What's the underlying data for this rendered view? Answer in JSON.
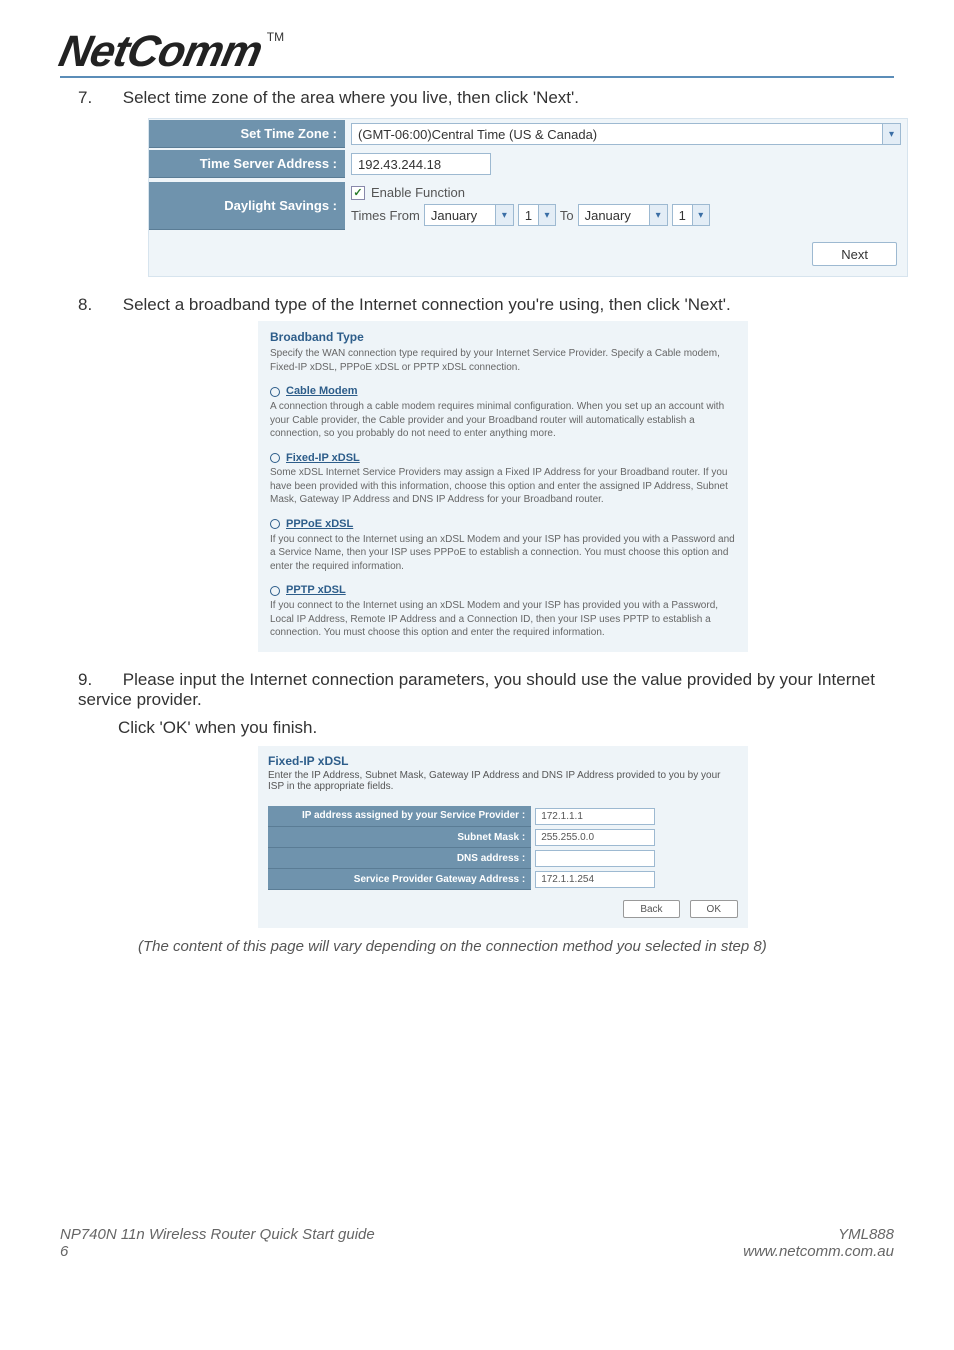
{
  "brand": {
    "name": "NetComm",
    "tm": "TM"
  },
  "steps": {
    "s7": {
      "num": "7.",
      "text": "Select time zone of the area where you live, then click 'Next'."
    },
    "s8": {
      "num": "8.",
      "text": "Select a broadband type of the Internet connection you're using, then click 'Next'."
    },
    "s9": {
      "num": "9.",
      "text": "Please input the Internet connection parameters, you should use the value provided by your Internet service provider.",
      "text2": "Click 'OK' when you finish."
    }
  },
  "timezone": {
    "labels": {
      "zone": "Set Time Zone :",
      "server": "Time Server Address :",
      "dst": "Daylight Savings :"
    },
    "zone_value": "(GMT-06:00)Central Time (US & Canada)",
    "server_value": "192.43.244.18",
    "enable_label": "Enable Function",
    "times_from": "Times From",
    "month_from": "January",
    "day_from": "1",
    "to": "To",
    "month_to": "January",
    "day_to": "1",
    "next": "Next"
  },
  "broadband": {
    "title": "Broadband Type",
    "intro": "Specify the WAN connection type required by your Internet Service Provider. Specify a Cable modem, Fixed-IP xDSL, PPPoE xDSL or PPTP xDSL connection.",
    "opt1": {
      "title": "Cable Modem",
      "desc": "A connection through a cable modem requires minimal configuration. When you set up an account with your Cable provider, the Cable provider and your Broadband router will automatically establish a connection, so you probably do not need to enter anything more."
    },
    "opt2": {
      "title": "Fixed-IP xDSL",
      "desc": "Some xDSL Internet Service Providers may assign a Fixed IP Address for your Broadband router. If you have been provided with this information, choose this option and enter the assigned IP Address, Subnet Mask, Gateway IP Address and DNS IP Address for your Broadband router."
    },
    "opt3": {
      "title": "PPPoE xDSL",
      "desc": "If you connect to the Internet using an xDSL Modem and your ISP has provided you with a Password and a Service Name, then your ISP uses PPPoE to establish a connection. You must choose this option and enter the required information."
    },
    "opt4": {
      "title": "PPTP xDSL",
      "desc": "If you connect to the Internet using an xDSL Modem and your ISP has provided you with a Password, Local IP Address, Remote IP Address and a Connection ID, then your ISP uses PPTP to establish a connection. You must choose this option and enter the required information."
    }
  },
  "fixedip": {
    "title": "Fixed-IP xDSL",
    "intro": "Enter the IP Address, Subnet Mask, Gateway IP Address and DNS IP Address provided to you by your ISP in the appropriate fields.",
    "rows": {
      "ip": {
        "label": "IP address assigned by your Service Provider :",
        "value": "172.1.1.1"
      },
      "mask": {
        "label": "Subnet Mask :",
        "value": "255.255.0.0"
      },
      "dns": {
        "label": "DNS address :",
        "value": ""
      },
      "gateway": {
        "label": "Service Provider Gateway Address :",
        "value": "172.1.1.254"
      }
    },
    "back": "Back",
    "ok": "OK"
  },
  "note": "(The content of this page will vary depending on the connection method you selected in step 8)",
  "footer": {
    "left1": "NP740N 11n Wireless Router Quick Start guide",
    "right1": "YML888",
    "left2": "6",
    "right2": "www.netcomm.com.au"
  }
}
